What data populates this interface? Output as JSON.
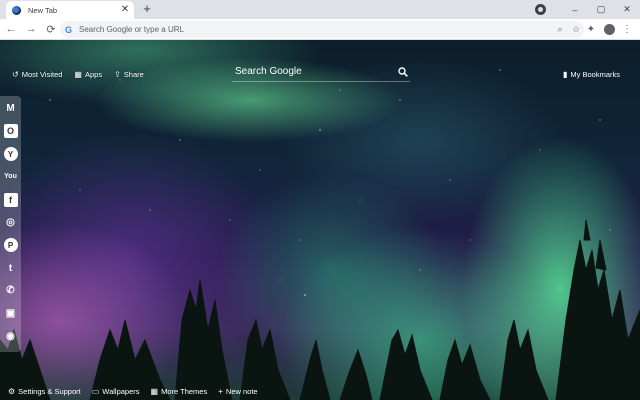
{
  "tab": {
    "title": "New Tab",
    "close_icon": "close-icon"
  },
  "new_tab_symbol": "+",
  "window_controls": {
    "minimize": "–",
    "maximize": "▢",
    "close": "✕"
  },
  "toolbar": {
    "back": "←",
    "forward": "→",
    "reload": "⟳",
    "omnibox_placeholder": "Search Google or type a URL",
    "google_letter": "G",
    "zoom_icon": "⌕",
    "star_icon": "☆",
    "extensions_icon": "✦",
    "menu_icon": "⋮"
  },
  "top_links": [
    {
      "label": "Most Visited",
      "icon": "↺"
    },
    {
      "label": "Apps",
      "icon": "▦"
    },
    {
      "label": "Share",
      "icon": "⇪"
    }
  ],
  "bookmarks": {
    "label": "My Bookmarks",
    "icon": "▮"
  },
  "search": {
    "placeholder": "Search Google",
    "icon": "⚲"
  },
  "sidebar": [
    {
      "name": "gmail",
      "glyph": "M"
    },
    {
      "name": "outlook",
      "glyph": "O"
    },
    {
      "name": "yahoo",
      "glyph": "Y"
    },
    {
      "name": "youtube",
      "glyph": "You"
    },
    {
      "name": "facebook",
      "glyph": "f"
    },
    {
      "name": "instagram",
      "glyph": "◎"
    },
    {
      "name": "pinterest",
      "glyph": "P"
    },
    {
      "name": "twitter",
      "glyph": "t"
    },
    {
      "name": "whatsapp",
      "glyph": "✆"
    },
    {
      "name": "app",
      "glyph": "▣"
    },
    {
      "name": "reddit",
      "glyph": "◉"
    }
  ],
  "bottom_links": [
    {
      "label": "Settings & Support",
      "icon": "⚙"
    },
    {
      "label": "Wallpapers",
      "icon": "▭"
    },
    {
      "label": "More Themes",
      "icon": "▦"
    },
    {
      "label": "New note",
      "icon": "+"
    }
  ]
}
